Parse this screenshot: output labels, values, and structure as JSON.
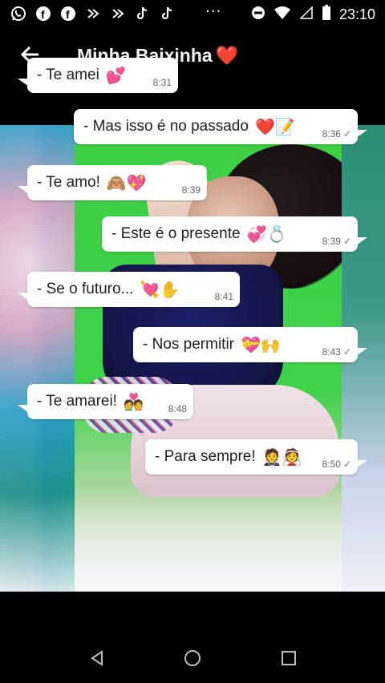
{
  "statusbar": {
    "time": "23:10",
    "left_icons": [
      "whatsapp-icon",
      "facebook-icon",
      "facebook-icon",
      "app-icon",
      "app-icon",
      "tiktok-icon",
      "tiktok-icon"
    ],
    "more": "···",
    "right_icons": [
      "do-not-disturb-icon",
      "wifi-icon",
      "signal-icon",
      "battery-icon"
    ]
  },
  "header": {
    "title": "Minha Baixinha",
    "title_emoji": "❤️"
  },
  "messages": [
    {
      "text": "- Te amei",
      "emoji": "💕",
      "time": "8:31",
      "direction": "in"
    },
    {
      "text": "- Mas isso é no passado",
      "emoji": "❤️📝",
      "time": "8:36",
      "direction": "out",
      "check": "✓"
    },
    {
      "text": "-  Te amo!",
      "emoji": "🙈💖",
      "time": "8:39",
      "direction": "in"
    },
    {
      "text": "- Este é o presente",
      "emoji": "💞💍",
      "time": "8:39",
      "direction": "out",
      "check": "✓"
    },
    {
      "text": "-  Se o futuro...",
      "emoji": "💘✋",
      "time": "8:41",
      "direction": "in"
    },
    {
      "text": "-  Nos permitir",
      "emoji": "💝🙌",
      "time": "8:43",
      "direction": "out",
      "check": "✓"
    },
    {
      "text": "- Te amarei!",
      "emoji": "💑",
      "time": "8:48",
      "direction": "in"
    },
    {
      "text": "- Para sempre!",
      "emoji": "🤵👰",
      "time": "8:50",
      "direction": "out",
      "check": "✓"
    }
  ],
  "navbar": {
    "buttons": [
      "back-triangle-icon",
      "home-circle-icon",
      "recents-square-icon"
    ]
  },
  "colors": {
    "bubble": "#ffffff",
    "status_bg": "#000000",
    "heart": "#e02424"
  }
}
